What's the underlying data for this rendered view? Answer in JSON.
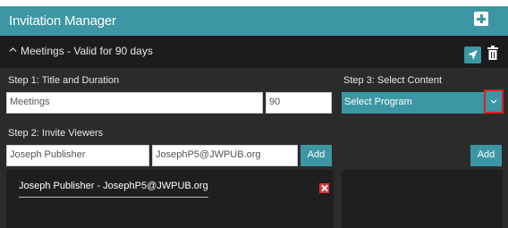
{
  "app": {
    "title": "Invitation Manager"
  },
  "meeting": {
    "section_title": "Meetings - Valid for 90 days"
  },
  "step1": {
    "label": "Step 1: Title and Duration",
    "title_value": "Meetings",
    "duration_value": "90"
  },
  "step2": {
    "label": "Step 2: Invite Viewers",
    "name_value": "Joseph Publisher",
    "email_value": "JosephP5@JWPUB.org",
    "add_label": "Add",
    "viewers": [
      {
        "text": "Joseph Publisher - JosephP5@JWPUB.org"
      }
    ]
  },
  "step3": {
    "label": "Step 3: Select Content",
    "selected_program": "Select Program",
    "add_label": "Add"
  },
  "colors": {
    "accent": "#3c96a3",
    "highlight_border": "#e02020",
    "remove": "#e03030"
  },
  "icons": {
    "add": "plus-icon",
    "collapse": "chevron-up-icon",
    "send": "send-icon",
    "delete": "trash-icon",
    "dropdown": "chevron-down-icon",
    "remove_viewer": "close-icon"
  }
}
